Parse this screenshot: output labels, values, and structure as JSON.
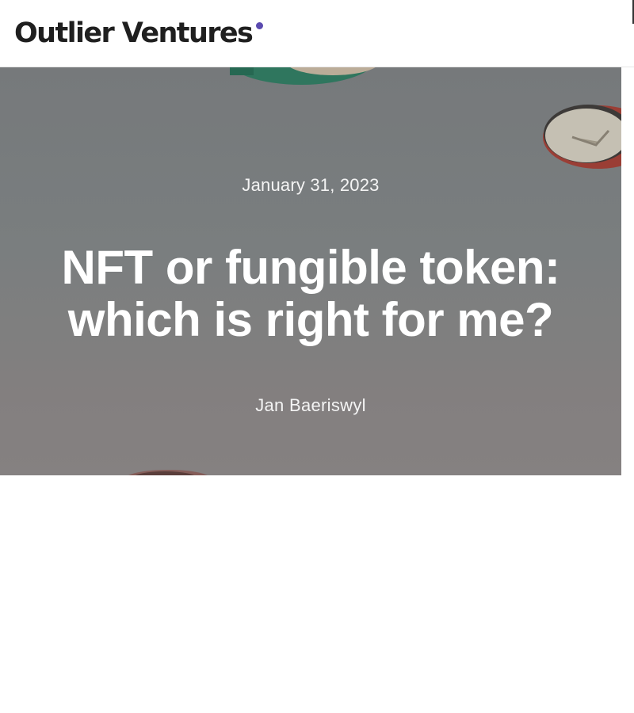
{
  "header": {
    "logo_text": "Outlier Ventures",
    "logo_dot_color": "#5b4bb0"
  },
  "hero": {
    "date": "January 31, 2023",
    "title": "NFT or fungible token: which is right for me?",
    "author": "Jan Baeriswyl",
    "background_image": "coins-illustration"
  }
}
